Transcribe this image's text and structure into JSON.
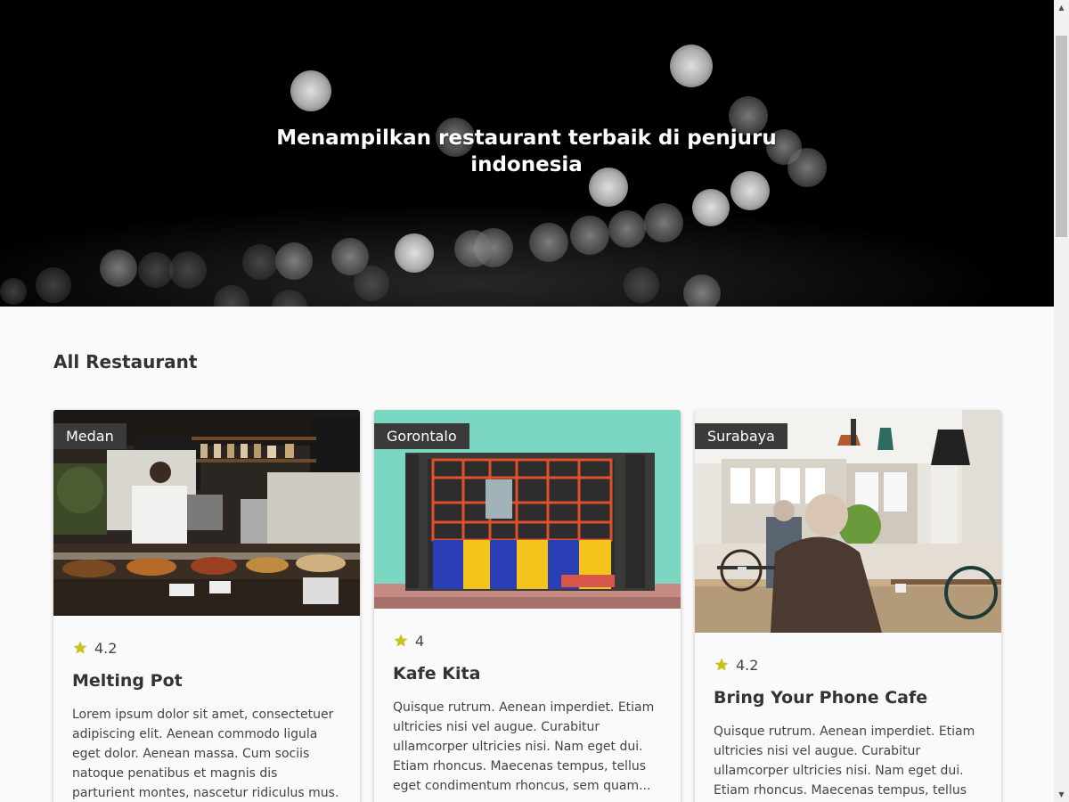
{
  "hero": {
    "title": "Menampilkan restaurant terbaik di penjuru indonesia"
  },
  "section": {
    "title": "All Restaurant"
  },
  "restaurants": [
    {
      "city": "Medan",
      "rating": "4.2",
      "name": "Melting Pot",
      "description": "Lorem ipsum dolor sit amet, consectetuer adipiscing elit. Aenean commodo ligula eget dolor. Aenean massa. Cum sociis natoque penatibus et magnis dis parturient montes, nascetur ridiculus mus. Donec..."
    },
    {
      "city": "Gorontalo",
      "rating": "4",
      "name": "Kafe Kita",
      "description": "Quisque rutrum. Aenean imperdiet. Etiam ultricies nisi vel augue. Curabitur ullamcorper ultricies nisi. Nam eget dui. Etiam rhoncus. Maecenas tempus, tellus eget condimentum rhoncus, sem quam..."
    },
    {
      "city": "Surabaya",
      "rating": "4.2",
      "name": "Bring Your Phone Cafe",
      "description": "Quisque rutrum. Aenean imperdiet. Etiam ultricies nisi vel augue. Curabitur ullamcorper ultricies nisi. Nam eget dui. Etiam rhoncus. Maecenas tempus, tellus"
    }
  ],
  "colors": {
    "star": "#c8c21a",
    "badge": "#3a3a3a",
    "hero_bg": "#000000"
  },
  "icons": {
    "rating": "star-icon"
  }
}
